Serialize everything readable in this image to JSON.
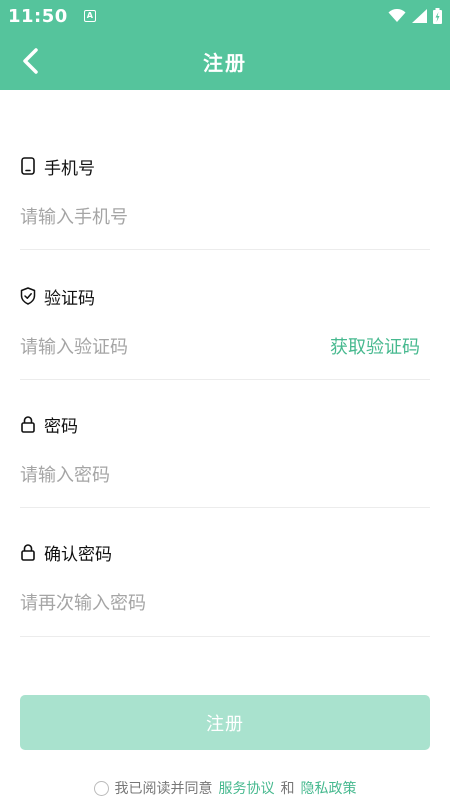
{
  "status_bar": {
    "time": "11:50",
    "notif_letter": "A"
  },
  "app_bar": {
    "title": "注册"
  },
  "fields": {
    "phone": {
      "label": "手机号",
      "placeholder": "请输入手机号",
      "value": ""
    },
    "code": {
      "label": "验证码",
      "placeholder": "请输入验证码",
      "value": "",
      "action": "获取验证码"
    },
    "password": {
      "label": "密码",
      "placeholder": "请输入密码",
      "value": ""
    },
    "confirm": {
      "label": "确认密码",
      "placeholder": "请再次输入密码",
      "value": ""
    }
  },
  "submit": {
    "label": "注册"
  },
  "agreement": {
    "prefix": "我已阅读并同意",
    "service": "服务协议",
    "and": "和",
    "privacy": "隐私政策",
    "checked": false
  },
  "colors": {
    "primary": "#55c49c",
    "link": "#47b98f",
    "button_disabled": "#a9e2ce"
  }
}
